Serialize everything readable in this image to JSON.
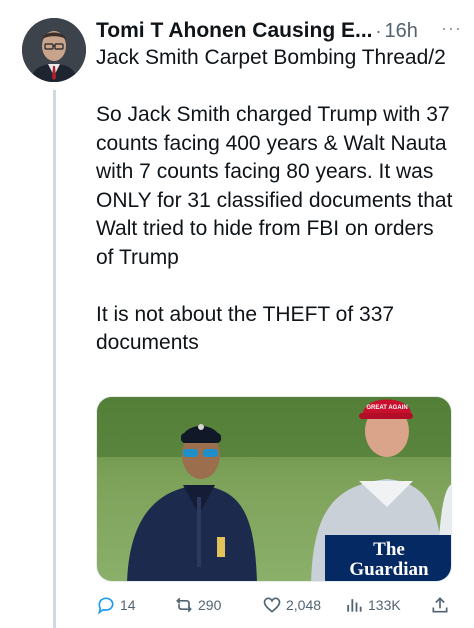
{
  "tweet": {
    "author": "Tomi T Ahonen Causing E...",
    "separator": "·",
    "time": "16h",
    "more": "···",
    "paragraphs": [
      "Jack Smith Carpet Bombing Thread/2",
      "So Jack Smith charged Trump with 37 counts facing 400 years & Walt Nauta with 7 counts facing 80 years. It was ONLY for 31 classified documents that Walt tried to hide from FBI on orders of Trump",
      "It is not about the THEFT of 337 documents"
    ],
    "media": {
      "watermark_line1": "The",
      "watermark_line2": "Guardian",
      "cap_text": "GREAT AGAIN"
    },
    "actions": {
      "replies": "14",
      "retweets": "290",
      "likes": "2,048",
      "views": "133K"
    }
  },
  "colors": {
    "text": "#0f1419",
    "muted": "#536471",
    "thread_line": "#cfd9de",
    "guardian_blue": "#052962"
  },
  "icons": [
    "avatar",
    "more-icon",
    "reply-icon",
    "retweet-icon",
    "like-icon",
    "views-icon",
    "share-icon"
  ]
}
